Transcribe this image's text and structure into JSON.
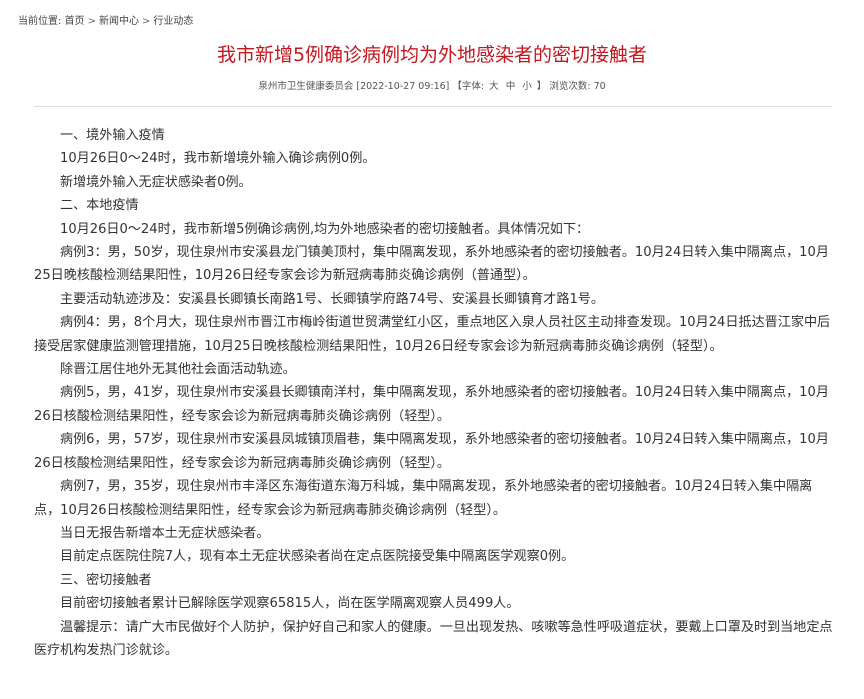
{
  "breadcrumb": {
    "label": "当前位置:",
    "items": [
      "首页",
      "新闻中心",
      "行业动态"
    ],
    "separator": ">"
  },
  "article": {
    "title": "我市新增5例确诊病例均为外地感染者的密切接触者",
    "meta": {
      "source": "泉州市卫生健康委员会",
      "datetime": "[2022-10-27 09:16]",
      "font_label": "【字体:",
      "font_sizes": [
        "大",
        "中",
        "小"
      ],
      "font_close": "】",
      "views_label": "浏览次数:",
      "views": "70"
    },
    "paragraphs": [
      "一、境外输入疫情",
      "10月26日0～24时，我市新增境外输入确诊病例0例。",
      "新增境外输入无症状感染者0例。",
      "二、本地疫情",
      "10月26日0～24时，我市新增5例确诊病例,均为外地感染者的密切接触者。具体情况如下：",
      "病例3：男，50岁，现住泉州市安溪县龙门镇美顶村，集中隔离发现，系外地感染者的密切接触者。10月24日转入集中隔离点，10月25日晚核酸检测结果阳性，10月26日经专家会诊为新冠病毒肺炎确诊病例（普通型）。",
      "主要活动轨迹涉及：安溪县长卿镇长南路1号、长卿镇学府路74号、安溪县长卿镇育才路1号。",
      "病例4：男，8个月大，现住泉州市晋江市梅岭街道世贸满堂红小区，重点地区入泉人员社区主动排查发现。10月24日抵达晋江家中后接受居家健康监测管理措施，10月25日晚核酸检测结果阳性，10月26日经专家会诊为新冠病毒肺炎确诊病例（轻型）。",
      "除晋江居住地外无其他社会面活动轨迹。",
      "病例5，男，41岁，现住泉州市安溪县长卿镇南洋村，集中隔离发现，系外地感染者的密切接触者。10月24日转入集中隔离点，10月26日核酸检测结果阳性，经专家会诊为新冠病毒肺炎确诊病例（轻型）。",
      "病例6，男，57岁，现住泉州市安溪县凤城镇顶眉巷，集中隔离发现，系外地感染者的密切接触者。10月24日转入集中隔离点，10月26日核酸检测结果阳性，经专家会诊为新冠病毒肺炎确诊病例（轻型）。",
      "病例7，男，35岁，现住泉州市丰泽区东海街道东海万科城，集中隔离发现，系外地感染者的密切接触者。10月24日转入集中隔离点，10月26日核酸检测结果阳性，经专家会诊为新冠病毒肺炎确诊病例（轻型）。",
      "当日无报告新增本土无症状感染者。",
      "目前定点医院住院7人，现有本土无症状感染者尚在定点医院接受集中隔离医学观察0例。",
      "三、密切接触者",
      "目前密切接触者累计已解除医学观察65815人，尚在医学隔离观察人员499人。",
      "温馨提示：请广大市民做好个人防护，保护好自己和家人的健康。一旦出现发热、咳嗽等急性呼吸道症状，要戴上口罩及时到当地定点医疗机构发热门诊就诊。"
    ]
  }
}
